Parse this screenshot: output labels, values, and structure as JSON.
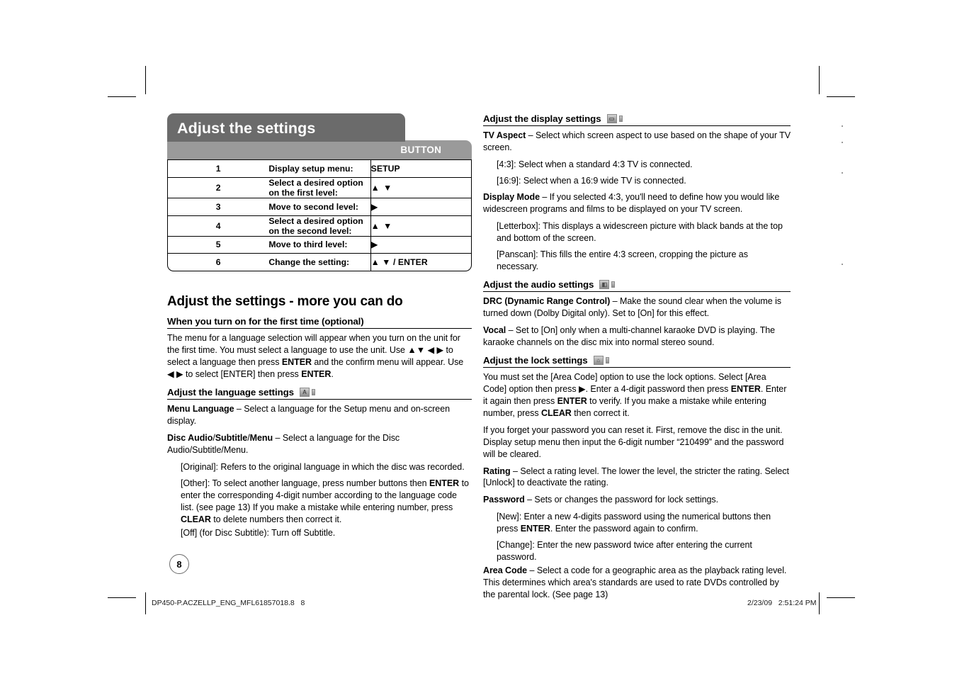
{
  "document": {
    "page_number": "8",
    "footer_file": "DP450-P.ACZELLP_ENG_MFL61857018.8   8",
    "footer_date": "2/23/09   2:51:24 PM"
  },
  "colors": {
    "banner_dark": "#6b6b6b",
    "table_header_gray": "#9a9a9a",
    "text": "#000000"
  },
  "banner": {
    "title": "Adjust the settings"
  },
  "button_table": {
    "header_blank": "",
    "header_button": "BUTTON",
    "rows": [
      {
        "num": "1",
        "step": "Display setup menu:",
        "button": "SETUP"
      },
      {
        "num": "2",
        "step": "Select a desired option on the first level:",
        "button": "▲ ▼"
      },
      {
        "num": "3",
        "step": "Move to second level:",
        "button": "▶"
      },
      {
        "num": "4",
        "step": "Select a desired option on the second level:",
        "button": "▲ ▼"
      },
      {
        "num": "5",
        "step": "Move to third level:",
        "button": "▶"
      },
      {
        "num": "6",
        "step": "Change the setting:",
        "button": "▲ ▼ / ENTER"
      }
    ]
  },
  "left_column": {
    "more_heading": "Adjust the settings - more you can do",
    "first_time": {
      "heading": "When you turn on for the first time (optional)",
      "paragraph_1": "The menu for a language selection will appear when you turn on the unit for the first time. You must select a language to use the unit. Use ",
      "paragraph_1b": " to select a language then press ",
      "paragraph_1c": " and the confirm menu will appear. Use ",
      "paragraph_1d": " to select [ENTER] then press ",
      "paragraph_1e": ".",
      "arrows_updown": "▲▼",
      "arrows_leftright": "◀ ▶",
      "enter_key": "ENTER"
    },
    "language_settings": {
      "heading": "Adjust the language settings",
      "icon": "language-letter-a-icon",
      "icon_glyph": "A",
      "menu_language_label": "Menu Language",
      "menu_language_text": " – Select a language for the Setup menu and on-screen display.",
      "disc_audio_label_a": "Disc Audio",
      "disc_audio_sep1": "/",
      "disc_audio_label_b": "Subtitle",
      "disc_audio_sep2": "/",
      "disc_audio_label_c": "Menu",
      "disc_audio_text": " – Select a language for the Disc Audio/Subtitle/Menu.",
      "original_text": "[Original]: Refers to the original language in which the disc was recorded.",
      "other_text_a": "[Other]: To select another language, press number buttons then ",
      "other_enter": "ENTER",
      "other_text_b": " to enter the corresponding 4-digit number according to the language code list. (see page 13) If you make a mistake while entering number, press ",
      "other_clear": "CLEAR",
      "other_text_c": " to delete numbers then correct it.",
      "off_text": "[Off] (for Disc Subtitle): Turn off Subtitle."
    }
  },
  "right_column": {
    "display_settings": {
      "heading": "Adjust the display settings",
      "icon": "tv-monitor-icon",
      "tv_aspect_label": "TV Aspect",
      "tv_aspect_text": " – Select which screen aspect to use based on the shape of your TV screen.",
      "aspect_43": "[4:3]: Select when a standard 4:3 TV is connected.",
      "aspect_169": "[16:9]: Select when a 16:9 wide TV is connected.",
      "display_mode_label": "Display Mode",
      "display_mode_text": " – If you selected 4:3, you'll need to define how you would like widescreen programs and films to be displayed on your TV screen.",
      "letterbox": "[Letterbox]: This displays a widescreen picture with black bands at the top and bottom of the screen.",
      "panscan": "[Panscan]: This fills the entire 4:3 screen, cropping the picture as necessary."
    },
    "audio_settings": {
      "heading": "Adjust the audio settings",
      "icon": "audio-speaker-icon",
      "drc_label": "DRC (Dynamic Range Control)",
      "drc_text": " – Make the sound clear when the volume is turned down (Dolby Digital only). Set to [On] for this effect.",
      "vocal_label": "Vocal",
      "vocal_text": " – Set to [On] only when a multi-channel karaoke DVD is playing. The karaoke channels on the disc mix into normal stereo sound."
    },
    "lock_settings": {
      "heading": "Adjust the lock settings",
      "icon": "padlock-icon",
      "intro_a": "You must set the [Area Code] option to use the lock options. Select [Area Code] option then press ▶. Enter a 4-digit password then press ",
      "intro_enter1": "ENTER",
      "intro_b": ". Enter it again then press ",
      "intro_enter2": "ENTER",
      "intro_c": " to verify. If you make a mistake while entering number, press ",
      "intro_clear": "CLEAR",
      "intro_d": " then correct it.",
      "reset_text": "If you forget your password you can reset it. First, remove the disc in the unit. Display setup menu then input the 6-digit number “210499” and the password will be cleared.",
      "rating_label": "Rating",
      "rating_text": " – Select a rating level. The lower the level, the stricter the rating. Select [Unlock] to deactivate the rating.",
      "password_label": "Password",
      "password_text": " – Sets or changes the password for lock settings.",
      "new_text_a": "[New]: Enter a new 4-digits password using the numerical buttons then press ",
      "new_enter": "ENTER",
      "new_text_b": ". Enter the password again to confirm.",
      "change_text": "[Change]: Enter the new password twice after entering the current password.",
      "area_code_label": "Area Code",
      "area_code_text": " – Select a code for a geographic area as the playback rating level. This determines which area's standards are used to rate DVDs controlled by the parental lock. (See page 13)"
    }
  }
}
